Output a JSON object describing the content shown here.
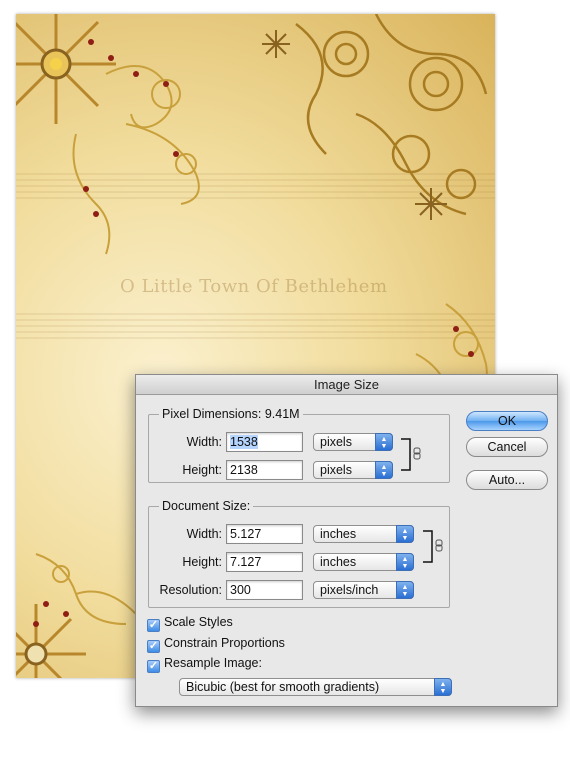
{
  "background": {
    "music_title": "O Little Town Of Bethlehem"
  },
  "dialog": {
    "title": "Image Size",
    "pixel_dimensions": {
      "title": "Pixel Dimensions:  9.41M",
      "width_label": "Width:",
      "width_value": "1538",
      "width_unit": "pixels",
      "height_label": "Height:",
      "height_value": "2138",
      "height_unit": "pixels"
    },
    "document_size": {
      "title": "Document Size:",
      "width_label": "Width:",
      "width_value": "5.127",
      "width_unit": "inches",
      "height_label": "Height:",
      "height_value": "7.127",
      "height_unit": "inches",
      "resolution_label": "Resolution:",
      "resolution_value": "300",
      "resolution_unit": "pixels/inch"
    },
    "buttons": {
      "ok": "OK",
      "cancel": "Cancel",
      "auto": "Auto..."
    },
    "checkboxes": {
      "scale_styles": "Scale Styles",
      "constrain_proportions": "Constrain Proportions",
      "resample_image": "Resample Image:"
    },
    "resample_method": "Bicubic (best for smooth gradients)"
  },
  "colors": {
    "accent": "#4c98ea",
    "gold": "#c9a13c"
  },
  "icons": {
    "link": "chain-link-icon",
    "popup_arrows": "up-down-arrows-icon",
    "checkmark": "checkmark-icon"
  }
}
